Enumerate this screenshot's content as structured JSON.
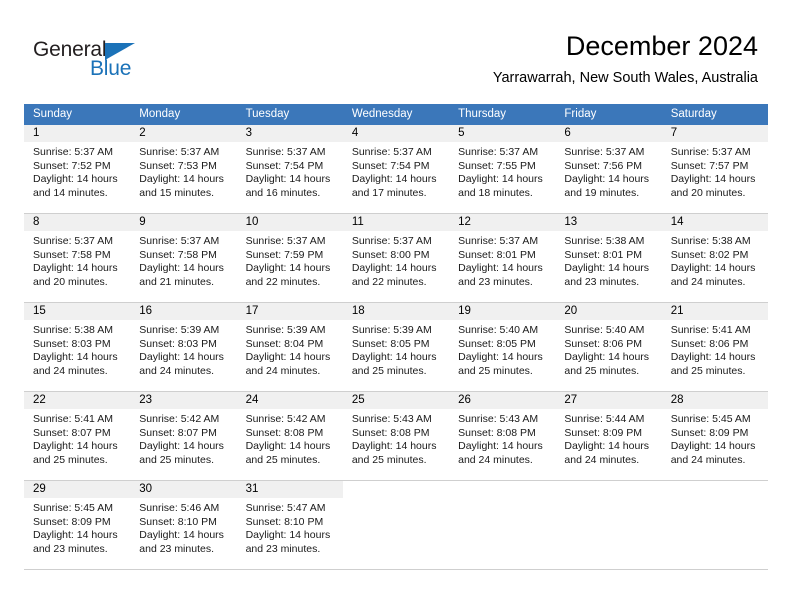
{
  "brand": {
    "name_dark": "General",
    "name_blue": "Blue",
    "dark_color": "#231f20",
    "blue_color": "#1b72b8"
  },
  "header": {
    "month_title": "December 2024",
    "location": "Yarrawarrah, New South Wales, Australia"
  },
  "theme": {
    "header_row_bg": "#3b77ba",
    "day_number_bg": "#f0f0f0",
    "grid_line": "#cfcfcf",
    "text": "#000000"
  },
  "weekdays": [
    "Sunday",
    "Monday",
    "Tuesday",
    "Wednesday",
    "Thursday",
    "Friday",
    "Saturday"
  ],
  "weeks": [
    [
      {
        "day": "1",
        "sunrise": "Sunrise: 5:37 AM",
        "sunset": "Sunset: 7:52 PM",
        "daylight1": "Daylight: 14 hours",
        "daylight2": "and 14 minutes."
      },
      {
        "day": "2",
        "sunrise": "Sunrise: 5:37 AM",
        "sunset": "Sunset: 7:53 PM",
        "daylight1": "Daylight: 14 hours",
        "daylight2": "and 15 minutes."
      },
      {
        "day": "3",
        "sunrise": "Sunrise: 5:37 AM",
        "sunset": "Sunset: 7:54 PM",
        "daylight1": "Daylight: 14 hours",
        "daylight2": "and 16 minutes."
      },
      {
        "day": "4",
        "sunrise": "Sunrise: 5:37 AM",
        "sunset": "Sunset: 7:54 PM",
        "daylight1": "Daylight: 14 hours",
        "daylight2": "and 17 minutes."
      },
      {
        "day": "5",
        "sunrise": "Sunrise: 5:37 AM",
        "sunset": "Sunset: 7:55 PM",
        "daylight1": "Daylight: 14 hours",
        "daylight2": "and 18 minutes."
      },
      {
        "day": "6",
        "sunrise": "Sunrise: 5:37 AM",
        "sunset": "Sunset: 7:56 PM",
        "daylight1": "Daylight: 14 hours",
        "daylight2": "and 19 minutes."
      },
      {
        "day": "7",
        "sunrise": "Sunrise: 5:37 AM",
        "sunset": "Sunset: 7:57 PM",
        "daylight1": "Daylight: 14 hours",
        "daylight2": "and 20 minutes."
      }
    ],
    [
      {
        "day": "8",
        "sunrise": "Sunrise: 5:37 AM",
        "sunset": "Sunset: 7:58 PM",
        "daylight1": "Daylight: 14 hours",
        "daylight2": "and 20 minutes."
      },
      {
        "day": "9",
        "sunrise": "Sunrise: 5:37 AM",
        "sunset": "Sunset: 7:58 PM",
        "daylight1": "Daylight: 14 hours",
        "daylight2": "and 21 minutes."
      },
      {
        "day": "10",
        "sunrise": "Sunrise: 5:37 AM",
        "sunset": "Sunset: 7:59 PM",
        "daylight1": "Daylight: 14 hours",
        "daylight2": "and 22 minutes."
      },
      {
        "day": "11",
        "sunrise": "Sunrise: 5:37 AM",
        "sunset": "Sunset: 8:00 PM",
        "daylight1": "Daylight: 14 hours",
        "daylight2": "and 22 minutes."
      },
      {
        "day": "12",
        "sunrise": "Sunrise: 5:37 AM",
        "sunset": "Sunset: 8:01 PM",
        "daylight1": "Daylight: 14 hours",
        "daylight2": "and 23 minutes."
      },
      {
        "day": "13",
        "sunrise": "Sunrise: 5:38 AM",
        "sunset": "Sunset: 8:01 PM",
        "daylight1": "Daylight: 14 hours",
        "daylight2": "and 23 minutes."
      },
      {
        "day": "14",
        "sunrise": "Sunrise: 5:38 AM",
        "sunset": "Sunset: 8:02 PM",
        "daylight1": "Daylight: 14 hours",
        "daylight2": "and 24 minutes."
      }
    ],
    [
      {
        "day": "15",
        "sunrise": "Sunrise: 5:38 AM",
        "sunset": "Sunset: 8:03 PM",
        "daylight1": "Daylight: 14 hours",
        "daylight2": "and 24 minutes."
      },
      {
        "day": "16",
        "sunrise": "Sunrise: 5:39 AM",
        "sunset": "Sunset: 8:03 PM",
        "daylight1": "Daylight: 14 hours",
        "daylight2": "and 24 minutes."
      },
      {
        "day": "17",
        "sunrise": "Sunrise: 5:39 AM",
        "sunset": "Sunset: 8:04 PM",
        "daylight1": "Daylight: 14 hours",
        "daylight2": "and 24 minutes."
      },
      {
        "day": "18",
        "sunrise": "Sunrise: 5:39 AM",
        "sunset": "Sunset: 8:05 PM",
        "daylight1": "Daylight: 14 hours",
        "daylight2": "and 25 minutes."
      },
      {
        "day": "19",
        "sunrise": "Sunrise: 5:40 AM",
        "sunset": "Sunset: 8:05 PM",
        "daylight1": "Daylight: 14 hours",
        "daylight2": "and 25 minutes."
      },
      {
        "day": "20",
        "sunrise": "Sunrise: 5:40 AM",
        "sunset": "Sunset: 8:06 PM",
        "daylight1": "Daylight: 14 hours",
        "daylight2": "and 25 minutes."
      },
      {
        "day": "21",
        "sunrise": "Sunrise: 5:41 AM",
        "sunset": "Sunset: 8:06 PM",
        "daylight1": "Daylight: 14 hours",
        "daylight2": "and 25 minutes."
      }
    ],
    [
      {
        "day": "22",
        "sunrise": "Sunrise: 5:41 AM",
        "sunset": "Sunset: 8:07 PM",
        "daylight1": "Daylight: 14 hours",
        "daylight2": "and 25 minutes."
      },
      {
        "day": "23",
        "sunrise": "Sunrise: 5:42 AM",
        "sunset": "Sunset: 8:07 PM",
        "daylight1": "Daylight: 14 hours",
        "daylight2": "and 25 minutes."
      },
      {
        "day": "24",
        "sunrise": "Sunrise: 5:42 AM",
        "sunset": "Sunset: 8:08 PM",
        "daylight1": "Daylight: 14 hours",
        "daylight2": "and 25 minutes."
      },
      {
        "day": "25",
        "sunrise": "Sunrise: 5:43 AM",
        "sunset": "Sunset: 8:08 PM",
        "daylight1": "Daylight: 14 hours",
        "daylight2": "and 25 minutes."
      },
      {
        "day": "26",
        "sunrise": "Sunrise: 5:43 AM",
        "sunset": "Sunset: 8:08 PM",
        "daylight1": "Daylight: 14 hours",
        "daylight2": "and 24 minutes."
      },
      {
        "day": "27",
        "sunrise": "Sunrise: 5:44 AM",
        "sunset": "Sunset: 8:09 PM",
        "daylight1": "Daylight: 14 hours",
        "daylight2": "and 24 minutes."
      },
      {
        "day": "28",
        "sunrise": "Sunrise: 5:45 AM",
        "sunset": "Sunset: 8:09 PM",
        "daylight1": "Daylight: 14 hours",
        "daylight2": "and 24 minutes."
      }
    ],
    [
      {
        "day": "29",
        "sunrise": "Sunrise: 5:45 AM",
        "sunset": "Sunset: 8:09 PM",
        "daylight1": "Daylight: 14 hours",
        "daylight2": "and 23 minutes."
      },
      {
        "day": "30",
        "sunrise": "Sunrise: 5:46 AM",
        "sunset": "Sunset: 8:10 PM",
        "daylight1": "Daylight: 14 hours",
        "daylight2": "and 23 minutes."
      },
      {
        "day": "31",
        "sunrise": "Sunrise: 5:47 AM",
        "sunset": "Sunset: 8:10 PM",
        "daylight1": "Daylight: 14 hours",
        "daylight2": "and 23 minutes."
      },
      {
        "day": "",
        "sunrise": "",
        "sunset": "",
        "daylight1": "",
        "daylight2": ""
      },
      {
        "day": "",
        "sunrise": "",
        "sunset": "",
        "daylight1": "",
        "daylight2": ""
      },
      {
        "day": "",
        "sunrise": "",
        "sunset": "",
        "daylight1": "",
        "daylight2": ""
      },
      {
        "day": "",
        "sunrise": "",
        "sunset": "",
        "daylight1": "",
        "daylight2": ""
      }
    ]
  ]
}
